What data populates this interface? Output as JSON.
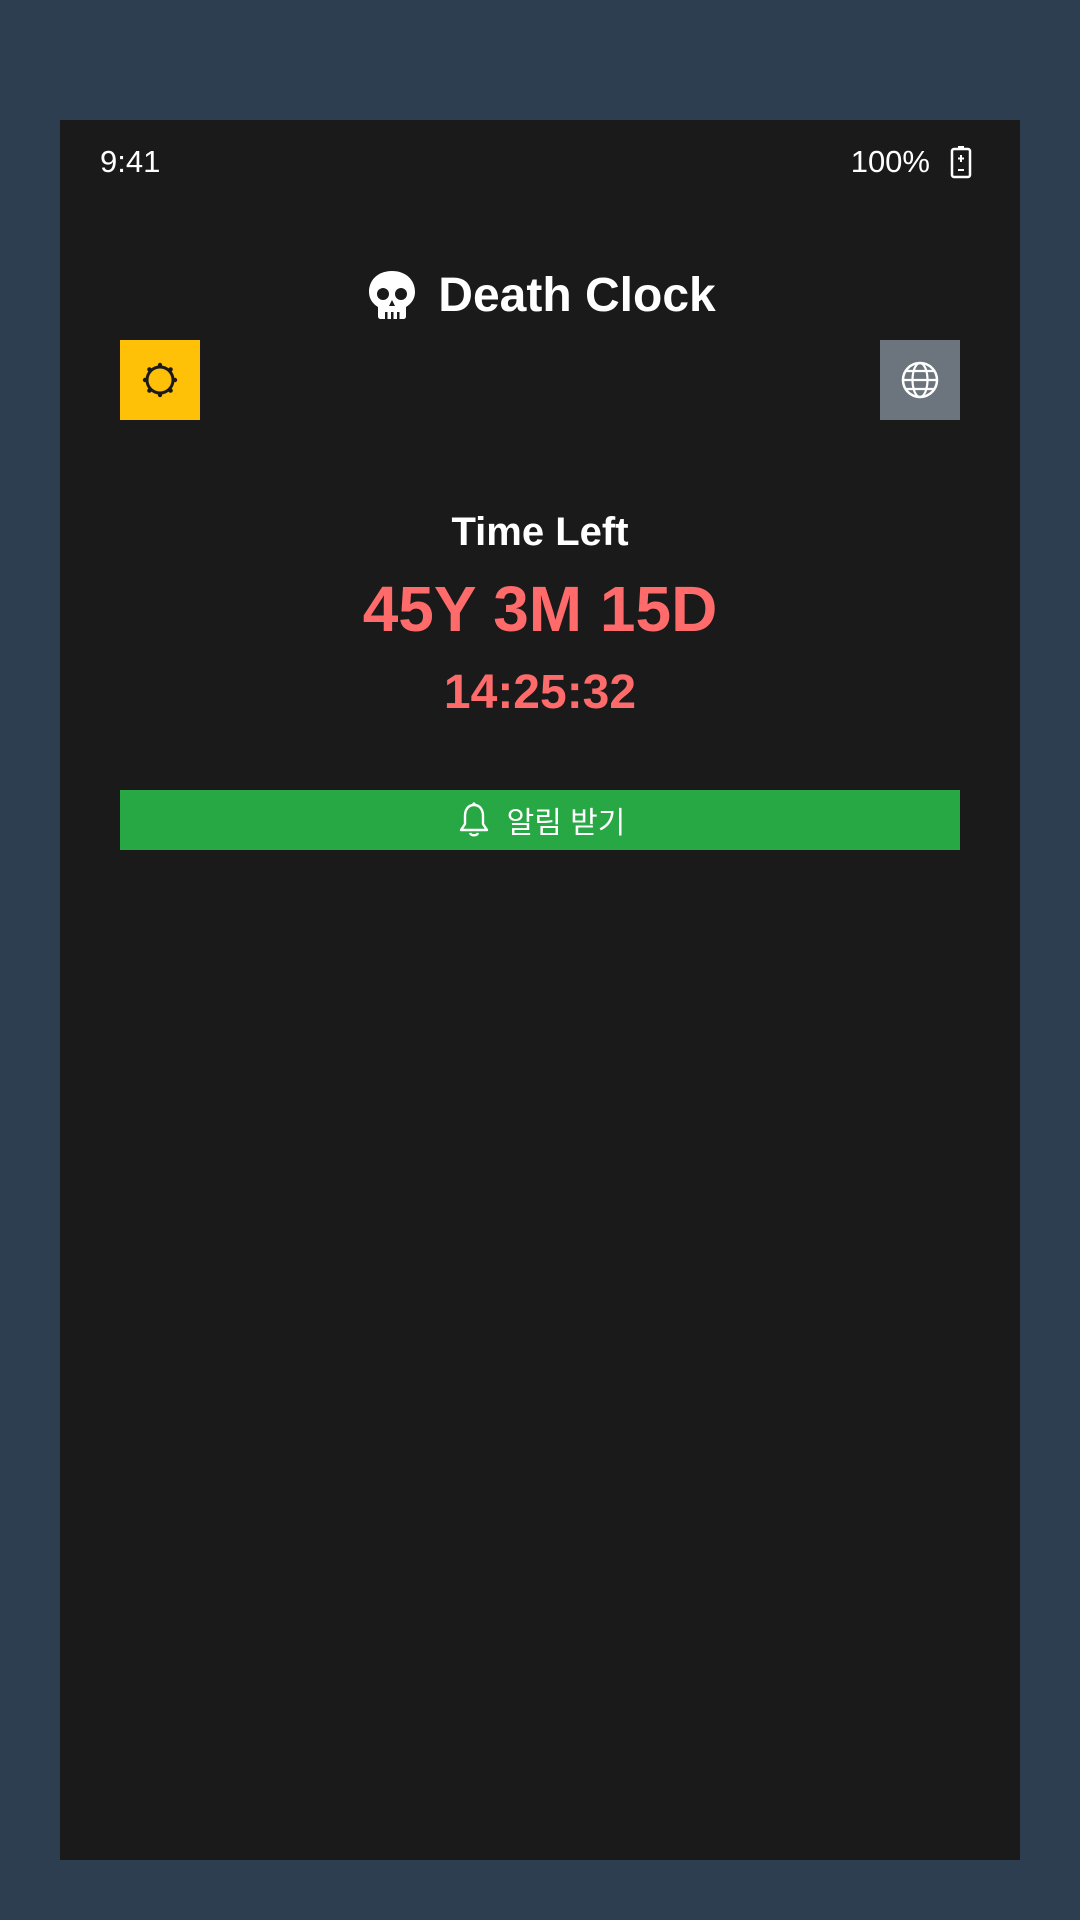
{
  "status_bar": {
    "time": "9:41",
    "battery": "100%",
    "battery_icon": "battery-charging-icon"
  },
  "header": {
    "title": "Death Clock",
    "icon": "skull-icon"
  },
  "controls": {
    "theme_icon": "sun-icon",
    "theme_color": "#ffc107",
    "language_icon": "globe-icon",
    "language_color": "#6c757d"
  },
  "countdown": {
    "label": "Time Left",
    "duration": "45Y 3M 15D",
    "clock": "14:25:32",
    "accent_color": "#ff6b6b"
  },
  "notify_button": {
    "icon": "bell-icon",
    "label": "알림 받기",
    "color": "#28a745"
  }
}
